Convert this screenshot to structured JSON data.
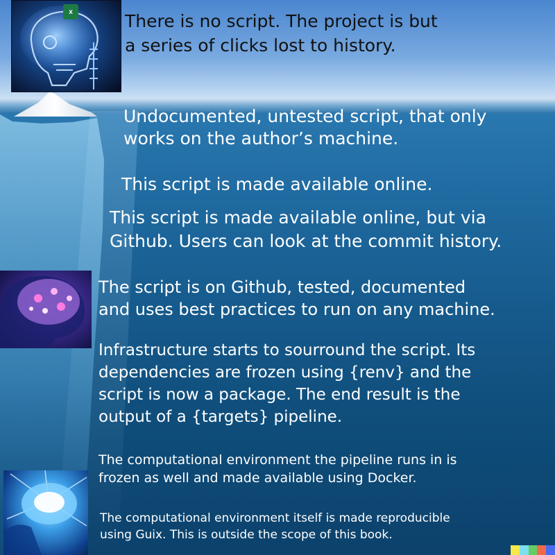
{
  "captions": {
    "level0": "There is no script. The project is but\na series of clicks lost to history.",
    "level1": "Undocumented, untested script, that only\nworks on the author’s machine.",
    "level2": "This script is made available online.",
    "level3": "This script is made available online, but via\nGithub. Users can look at the commit history.",
    "level4": "The script is on Github, tested, documented\nand uses best practices to run on any machine.",
    "level5": "Infrastructure starts to sourround the script. Its\ndependencies are frozen using {renv} and the\nscript is now a package. The end result is the\noutput of a {targets} pipeline.",
    "level6": "The computational environment the pipeline runs in is\nfrozen as well and made available using Docker.",
    "level7": "The computational environment itself is made reproducible\nusing Guix. This is outside the scope of this book."
  },
  "images": {
    "panel1": "xray-skull-excel-icon",
    "panel2": "glowing-brain-profile",
    "panel3": "radiant-brain-profile"
  },
  "colors": {
    "sky_top": "#4a86cf",
    "sea_deep": "#0c426c",
    "caption_light": "#ffffff",
    "caption_dark": "#111111",
    "excel_green": "#1d7a45"
  },
  "watermark_colors": [
    "#f7e94a",
    "#7be0f0",
    "#66cc66",
    "#f06a4a",
    "#4a6af0"
  ]
}
